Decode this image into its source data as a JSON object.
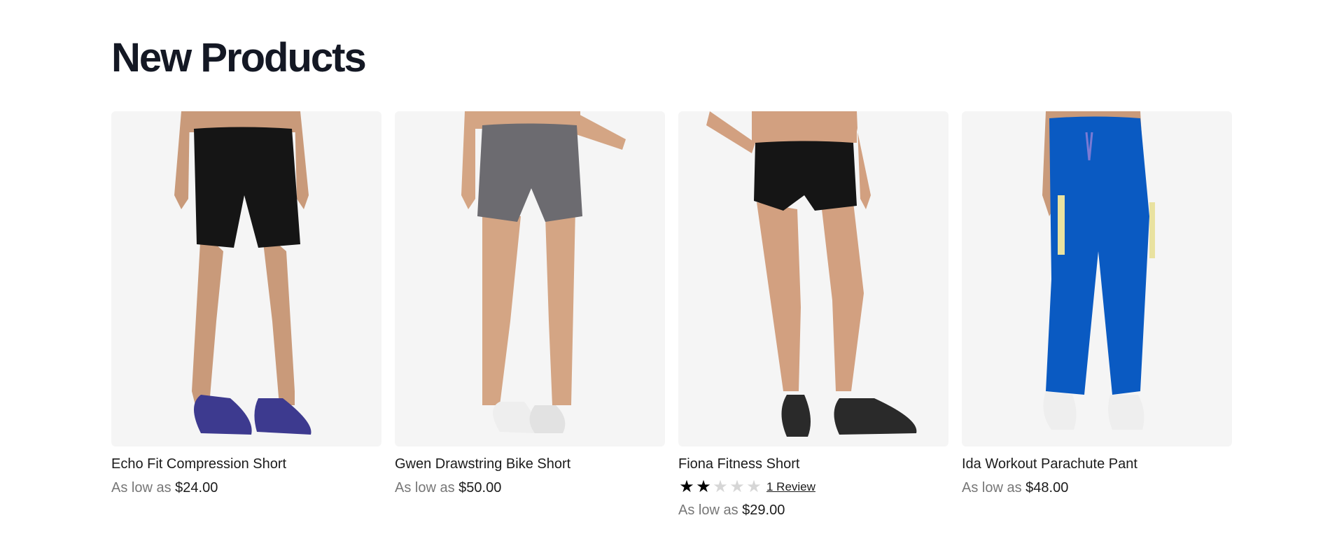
{
  "section": {
    "title": "New Products"
  },
  "colors": {
    "image_bg": "#f5f5f5",
    "title": "#141824",
    "muted": "#777777"
  },
  "products": [
    {
      "name": "Echo Fit Compression Short",
      "price_label": "As low as",
      "price": "$24.00",
      "garment_color": "#151515",
      "shoe_color": "#3d3a8f",
      "image_icon": "black-compression-short-photo"
    },
    {
      "name": "Gwen Drawstring Bike Short",
      "price_label": "As low as",
      "price": "$50.00",
      "garment_color": "#6c6b70",
      "shoe_color": "#eeeeee",
      "image_icon": "grey-bike-short-photo"
    },
    {
      "name": "Fiona Fitness Short",
      "rating": 2,
      "rating_max": 5,
      "review_text": "1  Review",
      "price_label": "As low as",
      "price": "$29.00",
      "garment_color": "#151515",
      "shoe_color": "#2a2a2a",
      "image_icon": "black-fitness-short-photo"
    },
    {
      "name": "Ida Workout Parachute Pant",
      "price_label": "As low as",
      "price": "$48.00",
      "garment_color": "#0a5ac2",
      "shoe_color": "#eeeeee",
      "image_icon": "blue-parachute-pant-photo"
    }
  ]
}
